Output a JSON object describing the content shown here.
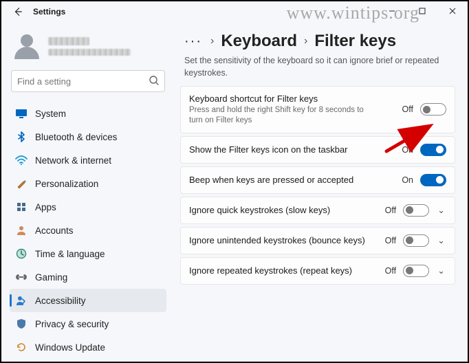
{
  "window": {
    "title": "Settings",
    "watermark": "www.wintips.org"
  },
  "account": {
    "name_line1": "",
    "name_line2": ""
  },
  "search": {
    "placeholder": "Find a setting"
  },
  "sidebar": {
    "items": [
      {
        "label": "System"
      },
      {
        "label": "Bluetooth & devices"
      },
      {
        "label": "Network & internet"
      },
      {
        "label": "Personalization"
      },
      {
        "label": "Apps"
      },
      {
        "label": "Accounts"
      },
      {
        "label": "Time & language"
      },
      {
        "label": "Gaming"
      },
      {
        "label": "Accessibility"
      },
      {
        "label": "Privacy & security"
      },
      {
        "label": "Windows Update"
      }
    ]
  },
  "breadcrumb": {
    "level1": "Keyboard",
    "level2": "Filter keys"
  },
  "description": "Set the sensitivity of the keyboard so it can ignore brief or repeated keystrokes.",
  "cards": [
    {
      "title": "Keyboard shortcut for Filter keys",
      "sub": "Press and hold the right Shift key for 8 seconds to turn on Filter keys",
      "state": "Off",
      "on": false,
      "expandable": false
    },
    {
      "title": "Show the Filter keys icon on the taskbar",
      "sub": "",
      "state": "On",
      "on": true,
      "expandable": false
    },
    {
      "title": "Beep when keys are pressed or accepted",
      "sub": "",
      "state": "On",
      "on": true,
      "expandable": false
    },
    {
      "title": "Ignore quick keystrokes (slow keys)",
      "sub": "",
      "state": "Off",
      "on": false,
      "expandable": true
    },
    {
      "title": "Ignore unintended keystrokes (bounce keys)",
      "sub": "",
      "state": "Off",
      "on": false,
      "expandable": true
    },
    {
      "title": "Ignore repeated keystrokes (repeat keys)",
      "sub": "",
      "state": "Off",
      "on": false,
      "expandable": true
    }
  ]
}
